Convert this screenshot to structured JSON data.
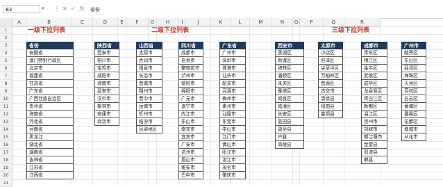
{
  "formula_bar": {
    "name_box": "B3",
    "dropdown_glyph": "▾",
    "cancel_glyph": "✕",
    "enter_glyph": "✓",
    "fx_glyph": "fx",
    "content": "省份"
  },
  "column_headers": [
    "A",
    "B",
    "C",
    "D",
    "E",
    "F",
    "G",
    "H",
    "I",
    "J",
    "K",
    "L",
    "M",
    "N",
    "O",
    "P",
    "Q",
    "R"
  ],
  "row_headers": [
    "1",
    "2",
    "3",
    "4",
    "5",
    "6",
    "7",
    "8",
    "9",
    "10",
    "11",
    "12",
    "13",
    "14",
    "15",
    "16",
    "17",
    "18",
    "19",
    "20",
    "21"
  ],
  "titles": {
    "level1": "一级下拉列表",
    "level2": "二级下拉列表",
    "level3": "三级下拉列表"
  },
  "tables": [
    {
      "header": "省份",
      "items": [
        "安徽省",
        "澳门特别行政区",
        "北京市",
        "福建省",
        "甘肃省",
        "广东省",
        "广西壮族自治区",
        "贵州省",
        "海南省",
        "河北省",
        "河南省",
        "黑龙江",
        "湖北省",
        "湖南省",
        "吉林省",
        "江苏省",
        "江西省"
      ]
    },
    {
      "header": "陕西省",
      "items": [
        "西安市",
        "铜川市",
        "宝鸡市",
        "咸阳市",
        "渭南市",
        "延安市",
        "汉中市",
        "榆林市",
        "安康市",
        "商洛市"
      ]
    },
    {
      "header": "山西省",
      "items": [
        "太原市",
        "大同市",
        "阳泉市",
        "长治市",
        "晋城市",
        "朔州市",
        "晋中市",
        "运城市",
        "忻州市",
        "临汾市",
        "吕梁地区"
      ]
    },
    {
      "header": "四川省",
      "items": [
        "成都市",
        "自贡市",
        "攀枝花市",
        "泸州市",
        "德阳市",
        "绵阳市",
        "广元市",
        "遂宁市",
        "内江市",
        "乐山市",
        "南充市",
        "宜宾市",
        "广安市",
        "达州市",
        "眉山市",
        "雅安市",
        "巴中市"
      ]
    },
    {
      "header": "广东省",
      "items": [
        "广州市",
        "深圳市",
        "珠海市",
        "汕头市",
        "韶关市",
        "河源市",
        "梅州市",
        "惠州市",
        "汕尾市",
        "东莞市",
        "中山市",
        "江门市",
        "佛山市",
        "阳江市",
        "湛江市",
        "茂名市",
        "肇庆市"
      ]
    },
    {
      "header": "西安市",
      "items": [
        "莲湖区",
        "新城区",
        "碑林区",
        "灞桥区",
        "未央区",
        "雁塔区",
        "阎良区",
        "临潼区",
        "长安区",
        "蓝田县",
        "周至县",
        "户县",
        "高陵县"
      ]
    },
    {
      "header": "太原市",
      "items": [
        "小店区",
        "迎泽区",
        "尖草坪区",
        "万柏林区",
        "晋源区",
        "古交市",
        "清徐县",
        "阳曲县",
        "娄烦县"
      ]
    },
    {
      "header": "成都市",
      "items": [
        "青羊区",
        "锦江区",
        "金牛区",
        "武侯区",
        "成华区",
        "龙泉驿区",
        "青白江区",
        "新都区",
        "温江区",
        "崇州市",
        "邛崃市",
        "都江堰市",
        "金堂县",
        "双流县",
        "郫县"
      ]
    },
    {
      "header": "广州市",
      "items": [
        "越秀区",
        "东山区",
        "荔湾区",
        "海珠区",
        "天河区",
        "芳村区",
        "白云区",
        "黄埔区",
        "番禺区",
        "花都区",
        "增城市",
        "从化市"
      ]
    }
  ]
}
